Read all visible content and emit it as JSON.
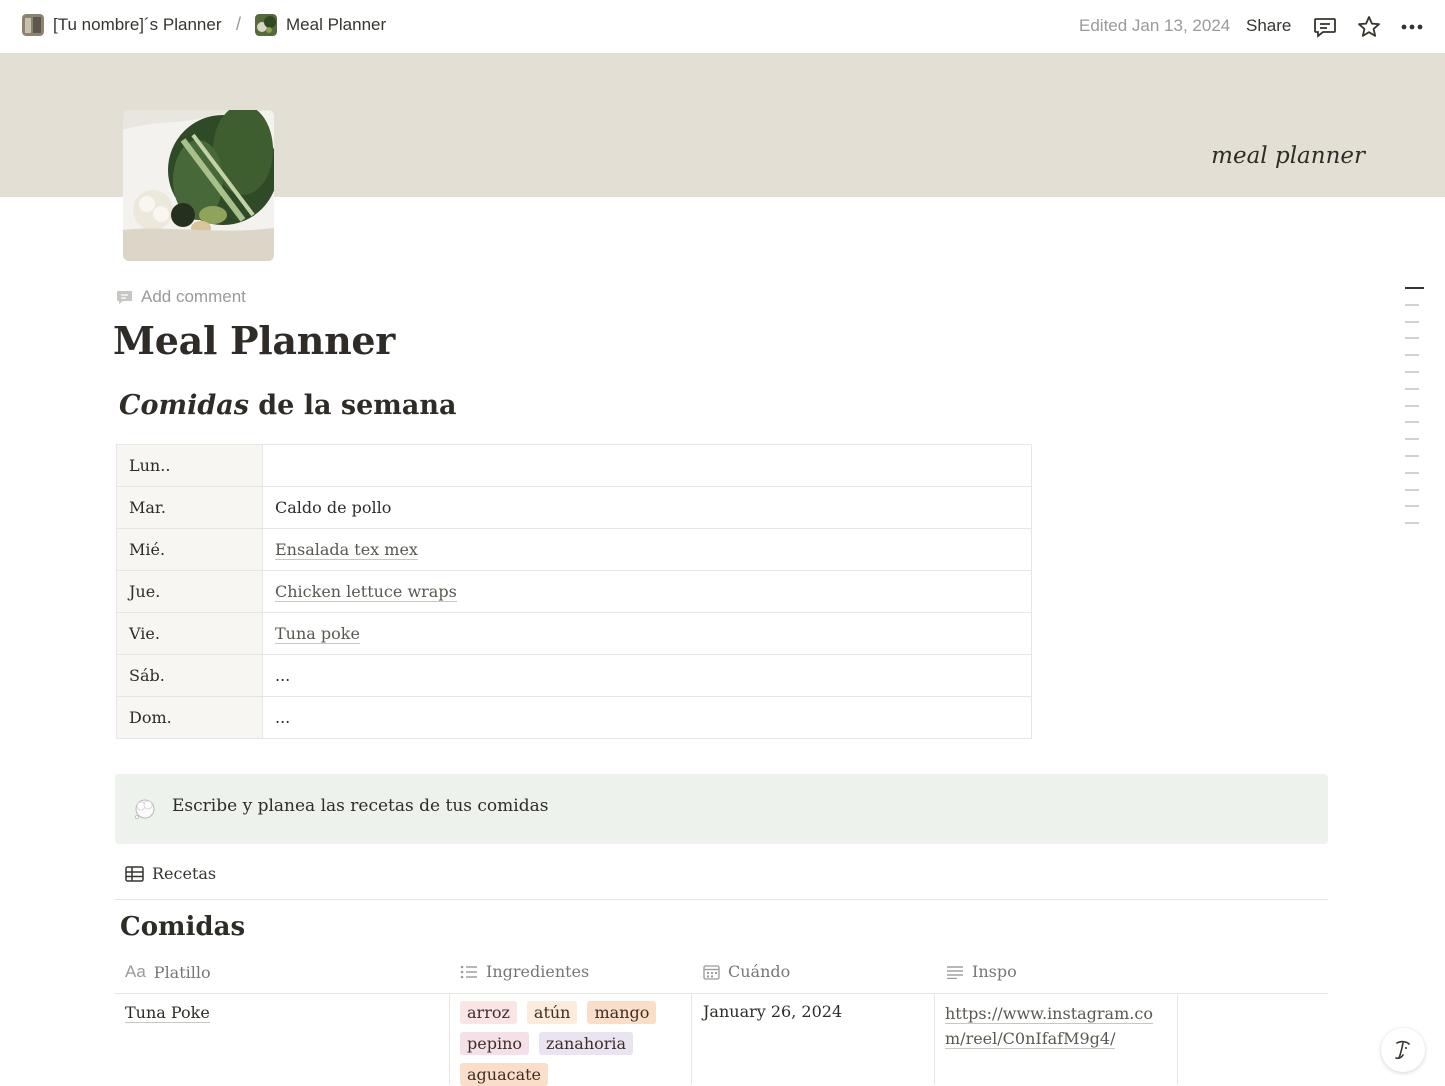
{
  "breadcrumb": {
    "parent": "[Tu nombre]´s Planner",
    "separator": "/",
    "current": "Meal Planner"
  },
  "topbar": {
    "edited": "Edited Jan 13, 2024",
    "share": "Share",
    "icons": [
      "comments-icon",
      "star-icon",
      "more-icon"
    ]
  },
  "cover": {
    "text": "meal planner",
    "color": "#e3dfd4"
  },
  "page": {
    "add_comment": "Add comment",
    "title": "Meal Planner"
  },
  "week": {
    "heading_em": "Comidas",
    "heading_rest": " de la semana",
    "rows": [
      {
        "day": "Lun..",
        "meal": ""
      },
      {
        "day": "Mar.",
        "meal": "Caldo de pollo"
      },
      {
        "day": "Mié.",
        "meal": "Ensalada tex mex"
      },
      {
        "day": "Jue.",
        "meal": "Chicken lettuce wraps"
      },
      {
        "day": "Vie.",
        "meal": "Tuna poke"
      },
      {
        "day": "Sáb.",
        "meal": "..."
      },
      {
        "day": "Dom.",
        "meal": "..."
      }
    ]
  },
  "callout": {
    "text": "Escribe y planea las recetas de tus comidas",
    "background": "#edf3ec"
  },
  "database": {
    "tab": "Recetas",
    "title": "Comidas",
    "columns": {
      "platillo": "Platillo",
      "ingredientes": "Ingredientes",
      "cuando": "Cuándo",
      "inspo": "Inspo"
    },
    "rows": [
      {
        "platillo": "Tuna Poke",
        "ingredientes": [
          {
            "name": "arroz",
            "color": "#fbe4e4"
          },
          {
            "name": "atún",
            "color": "#fbecdd"
          },
          {
            "name": "mango",
            "color": "#fadec9"
          },
          {
            "name": "pepino",
            "color": "#f5e0e9"
          },
          {
            "name": "zanahoria",
            "color": "#eae4f2"
          },
          {
            "name": "aguacate",
            "color": "#fadec9"
          }
        ],
        "cuando": "January 26, 2024",
        "inspo": "https://www.instagram.com/reel/C0nIfafM9g4/"
      }
    ]
  }
}
